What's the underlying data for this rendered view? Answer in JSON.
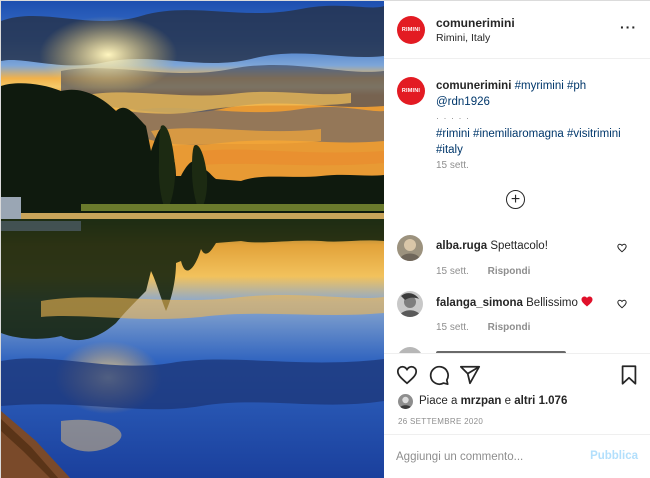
{
  "post": {
    "author": "comunerimini",
    "avatar_text": "RIMINI",
    "location": "Rimini, Italy",
    "more_icon": "ellipsis-icon"
  },
  "caption": {
    "username": "comunerimini",
    "line1_tags": "#myrimini #ph",
    "mention": "@rdn1926",
    "separator": "· · · · ·",
    "tags": "#rimini #inemiliaromagna #visitrimini #italy",
    "date": "15 sett."
  },
  "load_more_icon": "plus-circle-icon",
  "comments": [
    {
      "username": "alba.ruga",
      "text": "Spettacolo!",
      "emoji": "",
      "date": "15 sett.",
      "reply": "Rispondi"
    },
    {
      "username": "falanga_simona",
      "text": "Bellissimo",
      "emoji": "heart",
      "date": "15 sett.",
      "reply": "Rispondi"
    },
    {
      "username": "",
      "text": "",
      "emoji": "",
      "date": "",
      "reply": ""
    }
  ],
  "actions": {
    "like_icon": "heart-icon",
    "comment_icon": "comment-icon",
    "share_icon": "paper-plane-icon",
    "save_icon": "bookmark-icon"
  },
  "likes": {
    "prefix": "Piace a",
    "user": "mrzpan",
    "middle": "e",
    "others": "altri 1.076"
  },
  "post_date": "26 SETTEMBRE 2020",
  "add_comment": {
    "placeholder": "Aggiungi un commento...",
    "publish_label": "Pubblica"
  },
  "colors": {
    "brand_red": "#e31b23",
    "link_blue": "#00376b",
    "publish_disabled": "#b2dffc",
    "heart_red": "#ed4956"
  }
}
